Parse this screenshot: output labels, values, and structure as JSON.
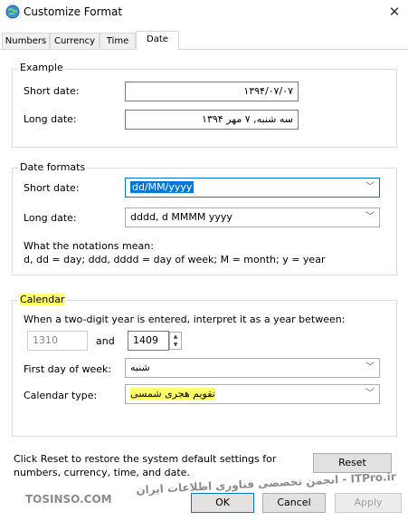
{
  "window": {
    "title": "Customize Format"
  },
  "tabs": [
    {
      "label": "Numbers"
    },
    {
      "label": "Currency"
    },
    {
      "label": "Time"
    },
    {
      "label": "Date"
    }
  ],
  "example": {
    "legend": "Example",
    "short_label": "Short date:",
    "short_value": "۱۳۹۴/۰۷/۰۷",
    "long_label": "Long date:",
    "long_value": "سه شنبه, ۷ مهر ۱۳۹۴"
  },
  "date_formats": {
    "legend": "Date formats",
    "short_label": "Short date:",
    "short_value": "dd/MM/yyyy",
    "long_label": "Long date:",
    "long_value": "dddd, d MMMM yyyy",
    "notation_title": "What the notations mean:",
    "notation_text": "d, dd = day;  ddd, dddd = day of week;  M = month;  y = year"
  },
  "calendar": {
    "legend": "Calendar",
    "two_digit_text": "When a two-digit year is entered, interpret it as a year between:",
    "year_from": "1310",
    "and_label": "and",
    "year_to": "1409",
    "first_day_label": "First day of week:",
    "first_day_value": "شنبه",
    "type_label": "Calendar type:",
    "type_value": "تقویم هجری شمسی"
  },
  "footer": {
    "reset_text_1": "Click Reset to restore the system default settings for",
    "reset_text_2": "numbers, currency, time, and date.",
    "reset_button": "Reset",
    "ok_button": "OK",
    "cancel_button": "Cancel",
    "apply_button": "Apply"
  },
  "watermarks": {
    "left": "TOSINSO.COM",
    "right": "ITPro.ir - انجمن تخصصی فناوری اطلاعات ایران"
  }
}
